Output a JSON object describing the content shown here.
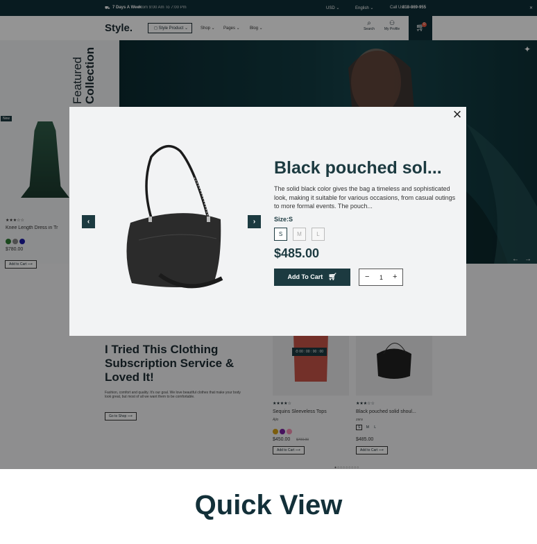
{
  "topbar": {
    "promo_bold": "7 Days A Week",
    "promo_text": "From 9:00 Am To 7:00 Pm",
    "currency": "USD",
    "language": "English",
    "call_label": "Call Us:",
    "phone": "818-869-955"
  },
  "header": {
    "logo": "Style.",
    "category_button": "Style Product",
    "nav": [
      "Shop",
      "Pages",
      "Blog"
    ],
    "search_label": "Search",
    "profile_label": "My Profile",
    "cart_count": "0"
  },
  "hero": {
    "featured_line1": "Featured",
    "featured_line2": "Collection"
  },
  "left_product": {
    "badge": "New",
    "name": "Knee Length Dress in Tr",
    "price": "$780.00",
    "cta": "Add to Cart",
    "rating": 3
  },
  "blog": {
    "title": "I Tried This Clothing Subscription Service & Loved It!",
    "text": "Fashion, comfort and quality. It's our goal. We love beautiful clothes that make your body look great, but most of all we want them to be comfortable.",
    "cta": "Go to Shop"
  },
  "products": [
    {
      "name": "Sequins Sleeveless Tops",
      "brand": "Ajio",
      "price": "$450.00",
      "old_price": "$700.00",
      "cta": "Add to Cart",
      "countdown": "00 : 00 : 00 : 00",
      "rating": 4
    },
    {
      "name": "Black pouched solid shoul...",
      "brand": "zara",
      "price": "$485.00",
      "cta": "Add to Cart",
      "sizes": [
        "S",
        "M",
        "L"
      ],
      "rating": 3
    }
  ],
  "modal": {
    "title": "Black pouched sol...",
    "description": "The solid black color gives the bag a timeless and sophisticated look, making it suitable for various occasions, from casual outings to more formal events. The pouch...",
    "size_label": "Size:S",
    "sizes": [
      "S",
      "M",
      "L"
    ],
    "selected_size": "S",
    "price": "$485.00",
    "add_to_cart": "Add To Cart",
    "quantity": "1",
    "minus": "−",
    "plus": "+"
  },
  "footer": {
    "title": "Quick View"
  },
  "colors": {
    "primary": "#1c3a40",
    "topbar": "#0f2f37"
  }
}
